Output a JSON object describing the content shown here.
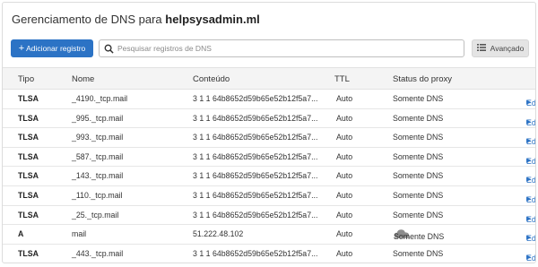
{
  "header": {
    "title_prefix": "Gerenciamento de DNS para",
    "domain": "helpsysadmin.ml"
  },
  "toolbar": {
    "add_label": "Adicionar registro",
    "search_placeholder": "Pesquisar registros de DNS",
    "advanced_label": "Avançado"
  },
  "table": {
    "columns": {
      "type": "Tipo",
      "name": "Nome",
      "content": "Conteúdo",
      "ttl": "TTL",
      "proxy": "Status do proxy"
    },
    "edit_label": "Editar",
    "rows": [
      {
        "type": "TLSA",
        "name": "_4190._tcp.mail",
        "content": "3 1 1 64b8652d59b65e52b12f5a7...",
        "ttl": "Auto",
        "proxy": "Somente DNS"
      },
      {
        "type": "TLSA",
        "name": "_995._tcp.mail",
        "content": "3 1 1 64b8652d59b65e52b12f5a7...",
        "ttl": "Auto",
        "proxy": "Somente DNS"
      },
      {
        "type": "TLSA",
        "name": "_993._tcp.mail",
        "content": "3 1 1 64b8652d59b65e52b12f5a7...",
        "ttl": "Auto",
        "proxy": "Somente DNS"
      },
      {
        "type": "TLSA",
        "name": "_587._tcp.mail",
        "content": "3 1 1 64b8652d59b65e52b12f5a7...",
        "ttl": "Auto",
        "proxy": "Somente DNS"
      },
      {
        "type": "TLSA",
        "name": "_143._tcp.mail",
        "content": "3 1 1 64b8652d59b65e52b12f5a7...",
        "ttl": "Auto",
        "proxy": "Somente DNS"
      },
      {
        "type": "TLSA",
        "name": "_110._tcp.mail",
        "content": "3 1 1 64b8652d59b65e52b12f5a7...",
        "ttl": "Auto",
        "proxy": "Somente DNS"
      },
      {
        "type": "TLSA",
        "name": "_25._tcp.mail",
        "content": "3 1 1 64b8652d59b65e52b12f5a7...",
        "ttl": "Auto",
        "proxy": "Somente DNS"
      },
      {
        "type": "A",
        "name": "mail",
        "content": "51.222.48.102",
        "ttl": "Auto",
        "proxy": "Somente DNS"
      },
      {
        "type": "TLSA",
        "name": "_443._tcp.mail",
        "content": "3 1 1 64b8652d59b65e52b12f5a7...",
        "ttl": "Auto",
        "proxy": "Somente DNS"
      }
    ]
  },
  "colors": {
    "accent": "#2c73c5",
    "cloud_grey": "#8c8c8c"
  }
}
